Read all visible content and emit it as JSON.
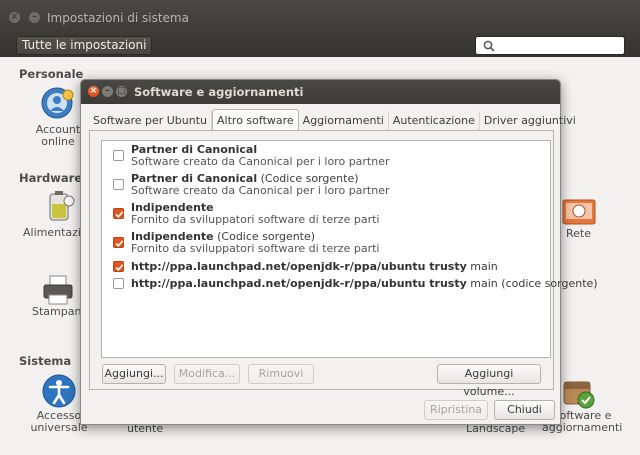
{
  "background_window": {
    "title": "Impostazioni di sistema",
    "all_settings_label": "Tutte le impostazioni",
    "sections": {
      "personal": "Personale",
      "hardware": "Hardware",
      "system": "Sistema"
    },
    "items": {
      "account_online_line1": "Account",
      "account_online_line2": "online",
      "power": "Alimentazio",
      "printer": "Stampant",
      "network": "Rete",
      "access_line1": "Accesso",
      "access_line2": "universale",
      "users": "utente",
      "landscape": "Landscape",
      "software_line1": "Software e",
      "software_line2": "aggiornamenti"
    }
  },
  "dialog": {
    "title": "Software e aggiornamenti",
    "tabs": [
      {
        "label": "Software per Ubuntu"
      },
      {
        "label": "Altro software"
      },
      {
        "label": "Aggiornamenti"
      },
      {
        "label": "Autenticazione"
      },
      {
        "label": "Driver aggiuntivi"
      }
    ],
    "active_tab": "Altro software",
    "sources": [
      {
        "bold": "Partner di Canonical",
        "suffix": "",
        "subtitle": "Software creato da Canonical per i loro partner",
        "checked": false
      },
      {
        "bold": "Partner di Canonical",
        "suffix": " (Codice sorgente)",
        "subtitle": "Software creato da Canonical per i loro partner",
        "checked": false
      },
      {
        "bold": "Indipendente",
        "suffix": "",
        "subtitle": "Fornito da sviluppatori software di terze parti",
        "checked": true
      },
      {
        "bold": "Indipendente",
        "suffix": " (Codice sorgente)",
        "subtitle": "Fornito da sviluppatori software di terze parti",
        "checked": true
      },
      {
        "bold": "http://ppa.launchpad.net/openjdk-r/ppa/ubuntu trusty",
        "suffix": " main",
        "subtitle": "",
        "checked": true
      },
      {
        "bold": "http://ppa.launchpad.net/openjdk-r/ppa/ubuntu trusty",
        "suffix": " main (codice sorgente)",
        "subtitle": "",
        "checked": false
      }
    ],
    "buttons": {
      "add": "Aggiungi...",
      "edit": "Modifica...",
      "remove": "Rimuovi",
      "add_volume": "Aggiungi volume...",
      "revert": "Ripristina",
      "close": "Chiudi"
    }
  },
  "colors": {
    "accent": "#df5420",
    "titlebar": "#3c3b37",
    "window_bg": "#f2f1f0"
  }
}
